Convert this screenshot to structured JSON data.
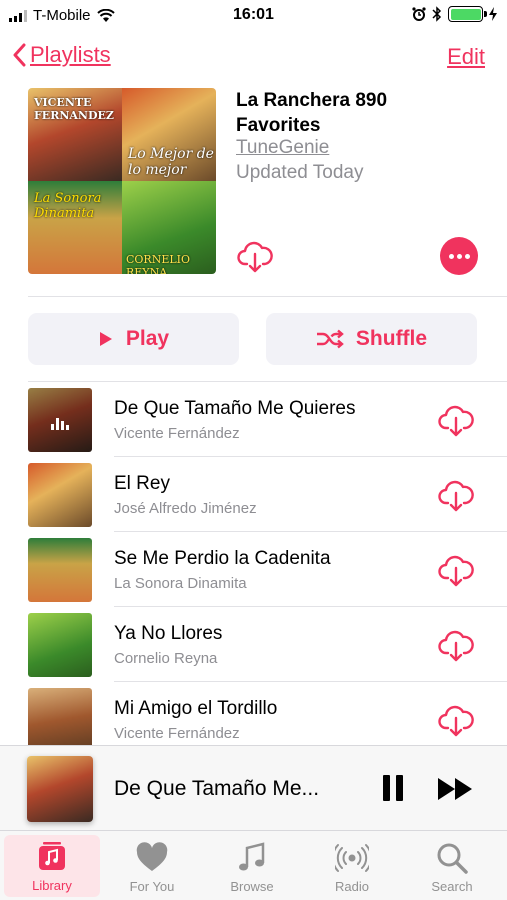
{
  "status_bar": {
    "carrier": "T-Mobile",
    "time": "16:01"
  },
  "nav": {
    "back_label": "Playlists",
    "edit_label": "Edit"
  },
  "playlist": {
    "title": "La Ranchera 890 Favorites",
    "author": "TuneGenie",
    "updated": "Updated Today",
    "art_texts": [
      "VICENTE FERNANDEZ",
      "Lo Mejor de lo mejor",
      "La Sonora Dinamita",
      "CORNELIO REYNA"
    ]
  },
  "actions": {
    "play_label": "Play",
    "shuffle_label": "Shuffle"
  },
  "songs": [
    {
      "title": "De Que Tamaño Me Quieres",
      "artist": "Vicente Fernández"
    },
    {
      "title": "El Rey",
      "artist": "José Alfredo Jiménez"
    },
    {
      "title": "Se Me Perdio la Cadenita",
      "artist": "La Sonora Dinamita"
    },
    {
      "title": "Ya No Llores",
      "artist": "Cornelio Reyna"
    },
    {
      "title": "Mi Amigo el Tordillo",
      "artist": "Vicente Fernández"
    }
  ],
  "now_playing": {
    "title": "De Que Tamaño Me..."
  },
  "tabs": [
    {
      "label": "Library",
      "icon": "library-icon",
      "active": true
    },
    {
      "label": "For You",
      "icon": "heart-icon",
      "active": false
    },
    {
      "label": "Browse",
      "icon": "music-note-icon",
      "active": false
    },
    {
      "label": "Radio",
      "icon": "radio-icon",
      "active": false
    },
    {
      "label": "Search",
      "icon": "search-icon",
      "active": false
    }
  ],
  "colors": {
    "accent": "#f0335e",
    "secondary_text": "#8e8e93",
    "battery": "#4cd964"
  }
}
